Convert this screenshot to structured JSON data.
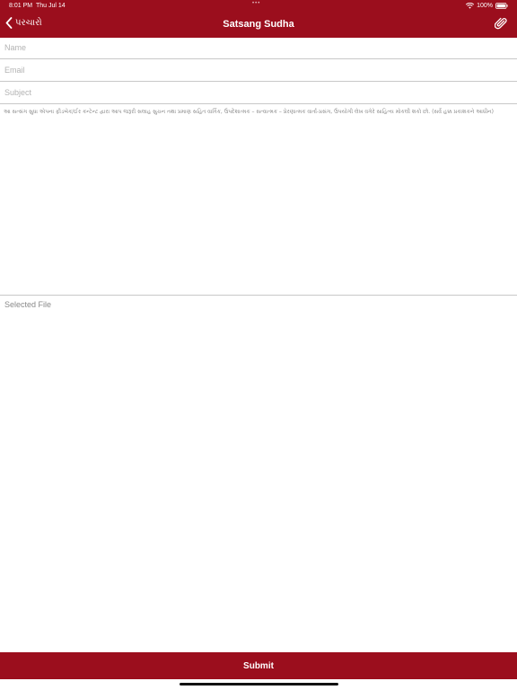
{
  "status_bar": {
    "time": "8:01 PM",
    "date": "Thu Jul 14",
    "dots": "•••",
    "battery": "100%"
  },
  "nav": {
    "back_label": "પરચારો",
    "title": "Satsang Sudha"
  },
  "form": {
    "name_placeholder": "Name",
    "email_placeholder": "Email",
    "subject_placeholder": "Subject",
    "message_placeholder": "આ સત્સંગ સુધા એપના ફીડબેક/ઈર કન્ટેન્ટ દ્વારા આપ જરૂરી સલાહ સુચન તથા પ્રમાણ સહિત વાર્તિક, ઉપદેશાત્મક – સત્વાત્મક – પ્રેરણાત્મક વાર્તા-પ્રસંગ, ઉપયોગી લેખ વગેરે સાહિત્ય મોકલી શકો છો. (સર્વે હક્ક પ્રકાશકને આધીન)",
    "selected_file_label": "Selected File",
    "submit_label": "Submit"
  },
  "colors": {
    "accent": "#9b0e1d"
  }
}
